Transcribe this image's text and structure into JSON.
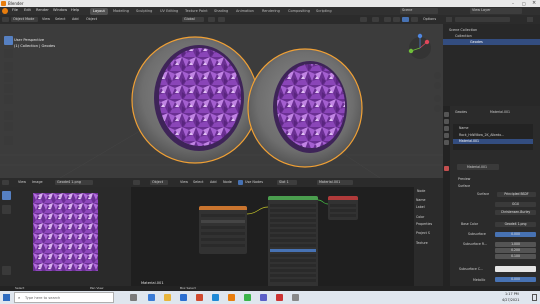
{
  "window": {
    "title": "Blender"
  },
  "menu": [
    "File",
    "Edit",
    "Render",
    "Window",
    "Help"
  ],
  "workspaces": {
    "tabs": [
      "Layout",
      "Modeling",
      "Sculpting",
      "UV Editing",
      "Texture Paint",
      "Shading",
      "Animation",
      "Rendering",
      "Compositing",
      "Scripting"
    ],
    "active": "Layout"
  },
  "scene": {
    "label": "Scene",
    "view_layer": "View Layer"
  },
  "viewport": {
    "mode": "Object Mode",
    "menus": [
      "View",
      "Select",
      "Add",
      "Object"
    ],
    "transform": "Global",
    "info_line1": "User Perspective",
    "info_line2": "(1) Collection | Geodes",
    "options": "Options"
  },
  "outliner": {
    "scene_collection": "Scene Collection",
    "collection": "Collection",
    "object": "Geodes"
  },
  "properties": {
    "object_name": "Geodes",
    "material_name": "Material.001",
    "slots": [
      "Name",
      "Rock_HdWillow_2K_Albedo...",
      "Material.001"
    ],
    "material_field": "Material.001",
    "preview": "Preview",
    "surface": "Surface",
    "surface_label": "Surface",
    "surface_value": "Principled BSDF",
    "ggx": "GGX",
    "subsurface_method": "Christensen-Burley",
    "base_color_label": "Base Color",
    "base_color_value": "Geode4 1.png",
    "subsurface_label": "Subsurface",
    "subsurface_value": "0.000",
    "subsurface_radius_label": "Subsurface R...",
    "sr1": "1.000",
    "sr2": "0.200",
    "sr3": "0.100",
    "subsurface_color_label": "Subsurface C...",
    "metallic_label": "Metallic",
    "metallic_value": "0.000"
  },
  "image_editor": {
    "menus": [
      "View",
      "Image"
    ],
    "image_name": "Geode4 1.png"
  },
  "node_editor": {
    "object": "Object",
    "menus": [
      "View",
      "Select",
      "Add",
      "Node"
    ],
    "use_nodes": "Use Nodes",
    "slot": "Slot 1",
    "material": "Material.001",
    "label_bottom": "Material.001",
    "sidebar_node": "Node",
    "sidebar_items": [
      "Name",
      "Label",
      "Color",
      "Properties",
      "Texture"
    ],
    "sidebar_project": "Project S",
    "sidebar_texture": "Texture"
  },
  "taskbar": {
    "search_placeholder": "Type here to search",
    "time": "1:17 PM",
    "date": "4/27/2021"
  },
  "statusbar": {
    "select": "Select",
    "box_select": "Box Select",
    "pan_view": "Pan View"
  },
  "colors": {
    "accent_blue": "#4772b3",
    "selection_orange": "#f0a035",
    "amethyst": "#8b4fb0"
  }
}
